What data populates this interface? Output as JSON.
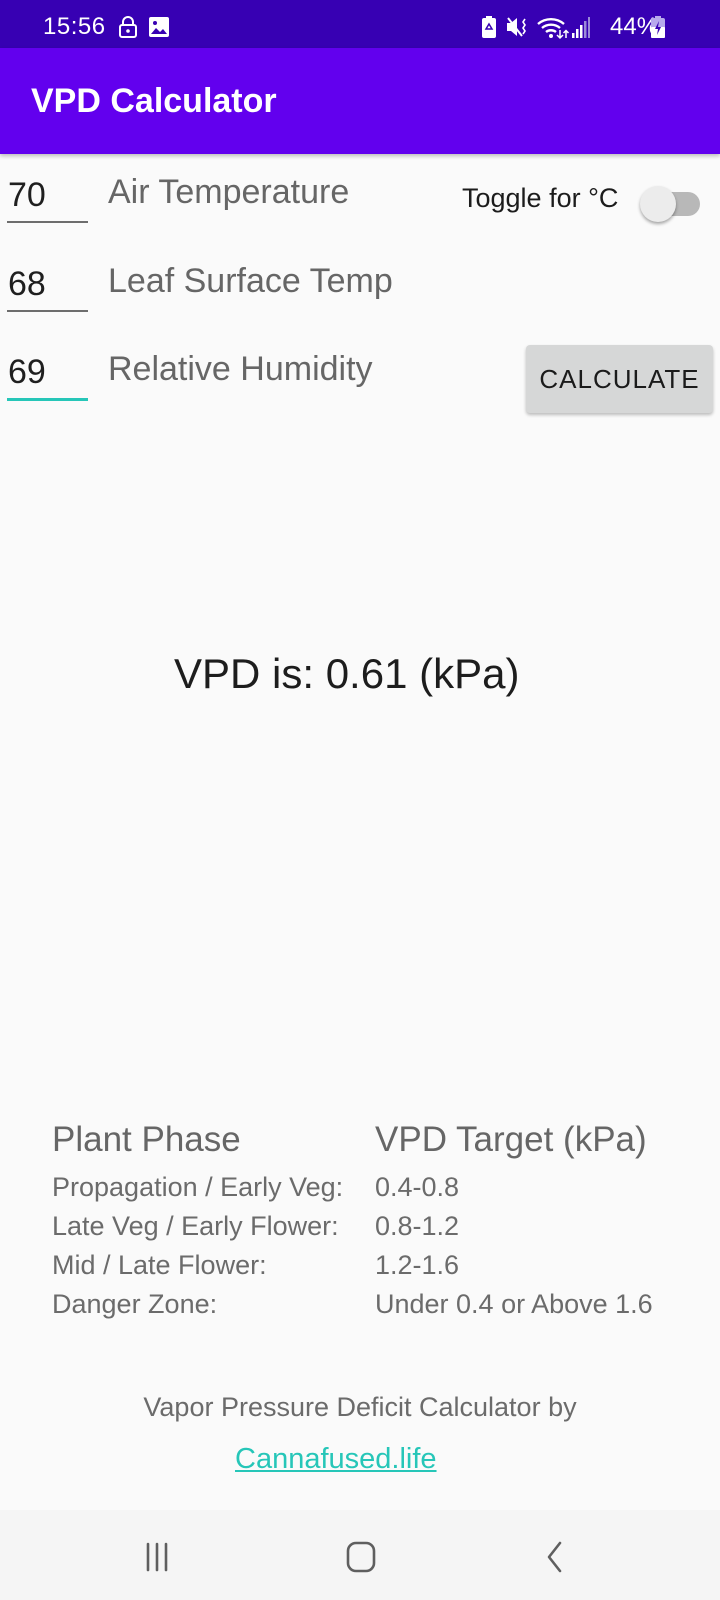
{
  "status_bar": {
    "time": "15:56",
    "left_icons": [
      "lock-icon",
      "image-icon"
    ],
    "right_icons": [
      "battery-saver-icon",
      "mute-vibrate-icon",
      "wifi-icon",
      "signal-icon",
      "battery-charging-icon"
    ],
    "battery_percent": "44%"
  },
  "app_bar": {
    "title": "VPD Calculator"
  },
  "inputs": [
    {
      "value": "70",
      "label": "Air Temperature"
    },
    {
      "value": "68",
      "label": "Leaf Surface Temp"
    },
    {
      "value": "69",
      "label": "Relative Humidity"
    }
  ],
  "toggle": {
    "label": "Toggle for °C",
    "checked": false
  },
  "calculate_button": {
    "label": "CALCULATE"
  },
  "result": {
    "text": "VPD is: 0.61 (kPa)"
  },
  "table": {
    "headers": [
      "Plant Phase",
      "VPD Target (kPa)"
    ],
    "rows": [
      [
        "Propagation / Early Veg:",
        "0.4-0.8"
      ],
      [
        "Late Veg / Early Flower:",
        "0.8-1.2"
      ],
      [
        "Mid / Late Flower:",
        "1.2-1.6"
      ],
      [
        "Danger Zone:",
        "Under 0.4 or Above 1.6"
      ]
    ]
  },
  "footer": {
    "credit_text": "Vapor Pressure Deficit Calculator by",
    "link_text": "Cannafused.life",
    "link_color": "#26c6b8"
  },
  "nav_bar": {
    "buttons": [
      "recent-apps",
      "home",
      "back"
    ]
  },
  "colors": {
    "primary": "#6200ee",
    "primary_dark": "#3700b3",
    "accent": "#26c6b8"
  }
}
